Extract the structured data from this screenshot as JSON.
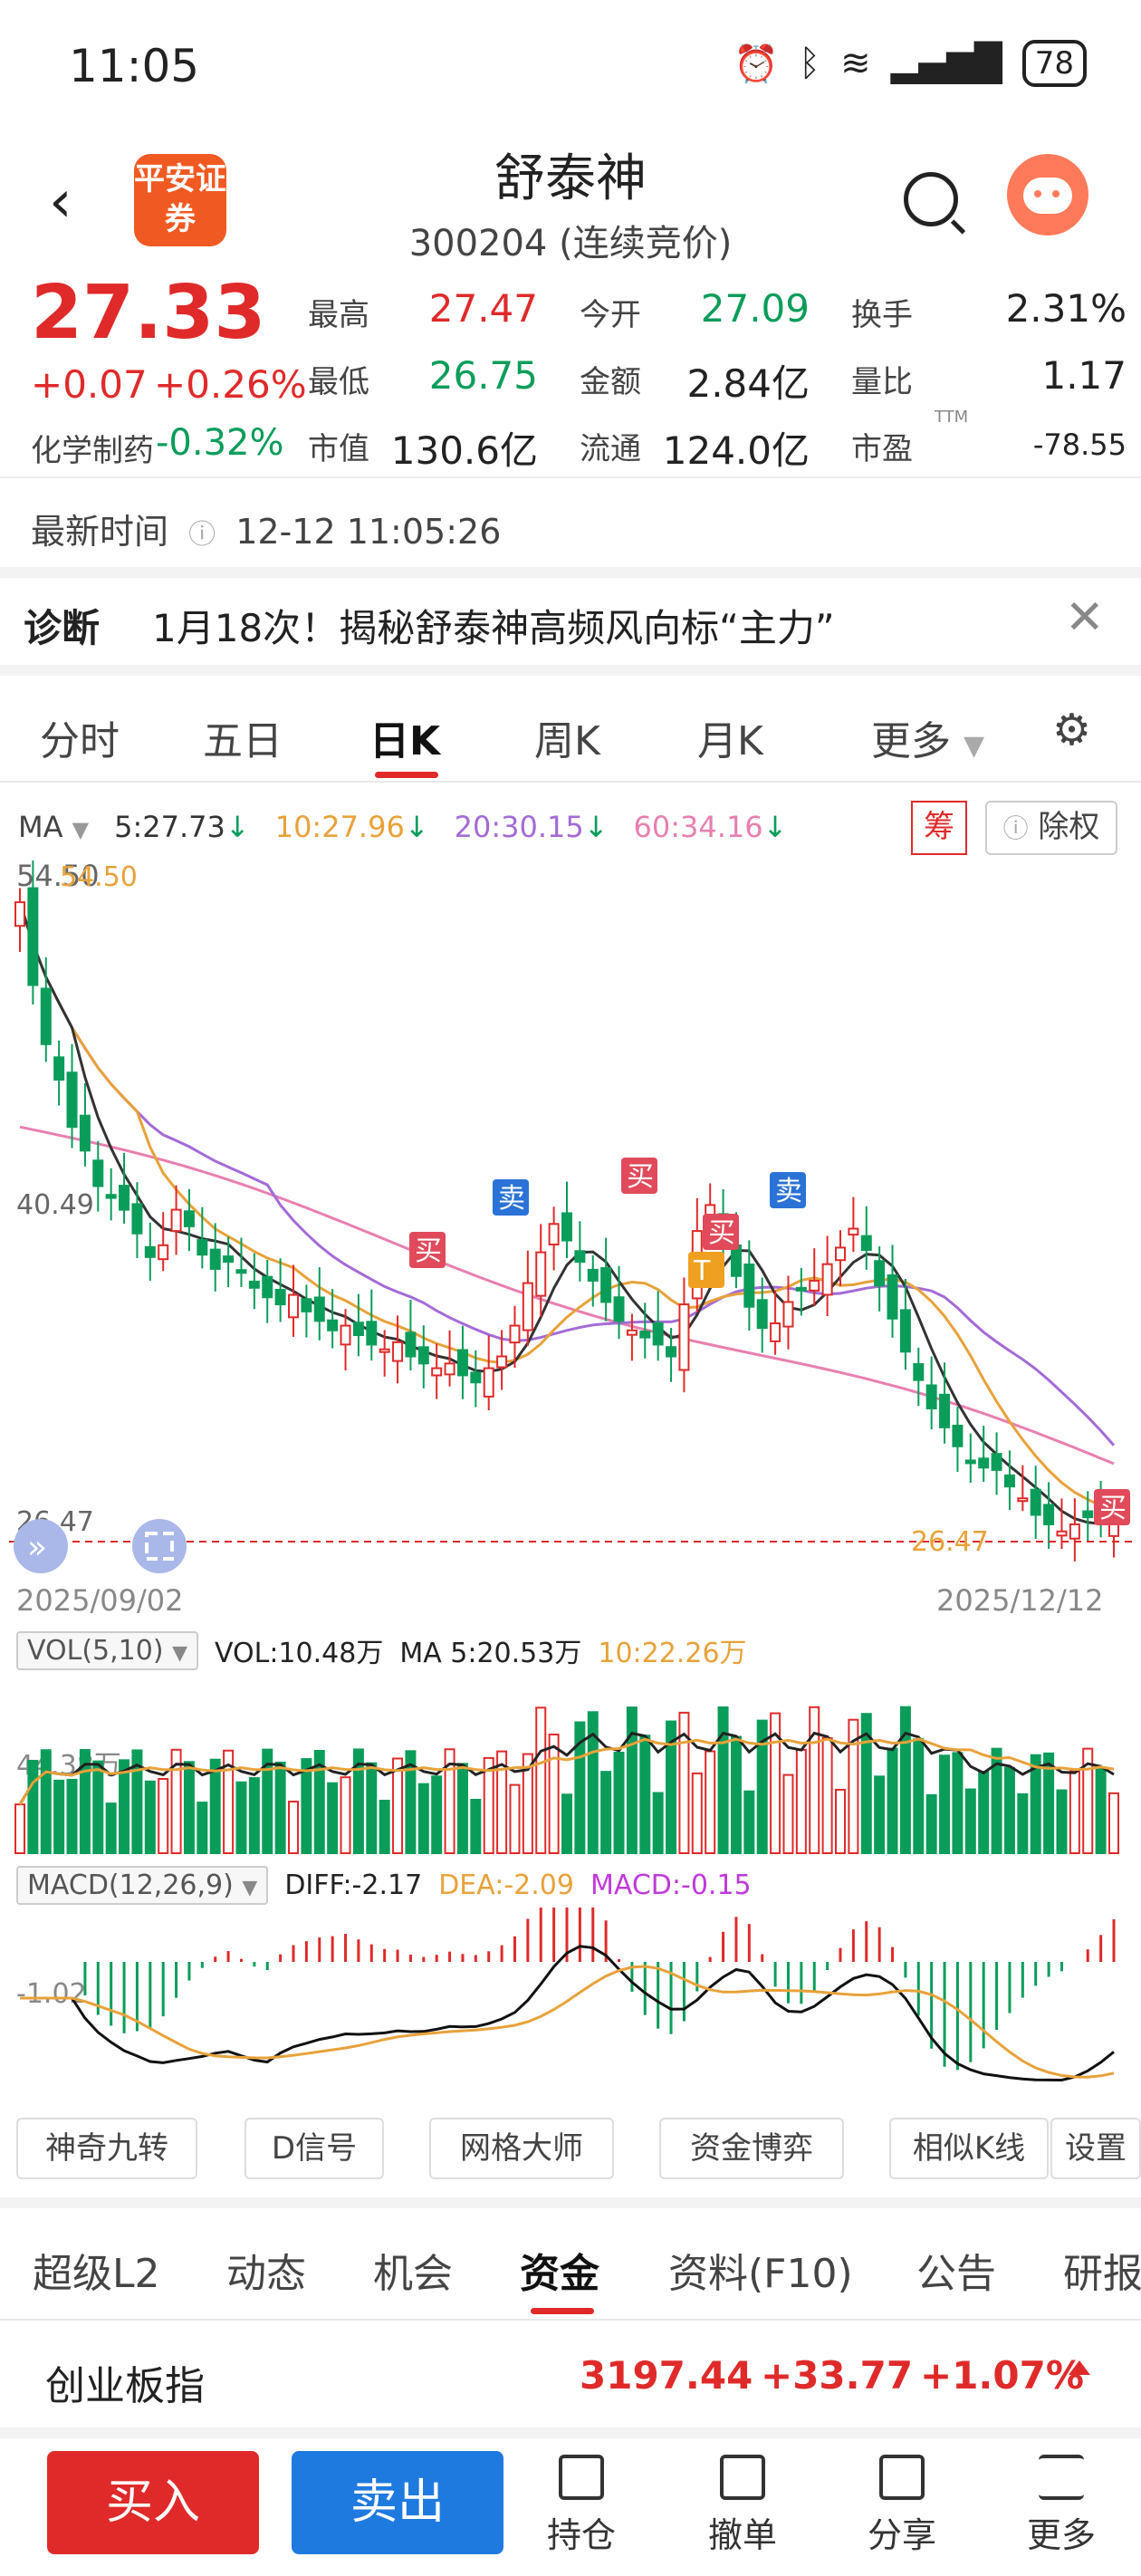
{
  "status_bar": {
    "time": "11:05",
    "battery": "78"
  },
  "header": {
    "stock_name": "舒泰神",
    "stock_code": "300204 (连续竞价)",
    "logo_text": "平安证券"
  },
  "quote": {
    "price": "27.33",
    "change": "+0.07",
    "change_pct": "+0.26%",
    "industry": "化学制药",
    "industry_change": "-0.32%",
    "fields": [
      {
        "label": "最高",
        "value": "27.47",
        "color": "red"
      },
      {
        "label": "今开",
        "value": "27.09",
        "color": "green"
      },
      {
        "label": "换手",
        "value": "2.31%",
        "color": "black"
      },
      {
        "label": "最低",
        "value": "26.75",
        "color": "green"
      },
      {
        "label": "金额",
        "value": "2.84亿",
        "color": "black"
      },
      {
        "label": "量比",
        "value": "1.17",
        "color": "black"
      },
      {
        "label": "市值",
        "value": "130.6亿",
        "color": "black"
      },
      {
        "label": "流通",
        "value": "124.0亿",
        "color": "black"
      },
      {
        "label": "市盈",
        "value": "-78.55",
        "color": "black"
      }
    ],
    "pe_suffix": "TTM",
    "update_label": "最新时间",
    "update_time": "12-12 11:05:26"
  },
  "diagnosis": {
    "label": "诊断",
    "text": "1月18次！揭秘舒泰神高频风向标“主力”"
  },
  "kline_tabs": [
    "分时",
    "五日",
    "日K",
    "周K",
    "月K",
    "更多"
  ],
  "ma_legend": {
    "label": "MA",
    "ma5": "5:27.73",
    "ma10": "10:27.96",
    "ma20": "20:30.15",
    "ma60": "60:34.16",
    "chou": "筹",
    "chuquan": "除权"
  },
  "chart_labels": {
    "high": "54.50",
    "high_mark": "54.50",
    "mid": "40.49",
    "low": "26.47",
    "low_mark": "26.47",
    "date_start": "2025/09/02",
    "date_end": "2025/12/12",
    "markers": [
      {
        "text": "买",
        "type": "buy"
      },
      {
        "text": "卖",
        "type": "sell"
      },
      {
        "text": "买",
        "type": "buy"
      },
      {
        "text": "买",
        "type": "buy"
      },
      {
        "text": "T",
        "type": "t"
      },
      {
        "text": "卖",
        "type": "sell"
      },
      {
        "text": "买",
        "type": "buy"
      }
    ]
  },
  "volume": {
    "indicator": "VOL(5,10)",
    "vol": "VOL:10.48万",
    "ma5": "MA 5:20.53万",
    "ma10": "10:22.26万",
    "axis": "44.38万"
  },
  "macd": {
    "indicator": "MACD(12,26,9)",
    "diff": "DIFF:-2.17",
    "dea": "DEA:-2.09",
    "macd": "MACD:-0.15",
    "axis": "-1.02"
  },
  "tools": [
    "神奇九转",
    "D信号",
    "网格大师",
    "资金博弈",
    "相似K线",
    "设置"
  ],
  "bottom_tabs": [
    "超级L2",
    "动态",
    "机会",
    "资金",
    "资料(F10)",
    "公告",
    "研报"
  ],
  "index_bar": {
    "name": "创业板指",
    "value": "3197.44",
    "change": "+33.77",
    "pct": "+1.07%"
  },
  "actions": {
    "buy": "买入",
    "sell": "卖出",
    "items": [
      "持仓",
      "撤单",
      "分享",
      "更多"
    ]
  },
  "colors": {
    "up": "#e02a2a",
    "down": "#0a9d5a",
    "ma5": "#333333",
    "ma10": "#e8a23a",
    "ma20": "#a46bd6",
    "ma60": "#e880b0"
  }
}
